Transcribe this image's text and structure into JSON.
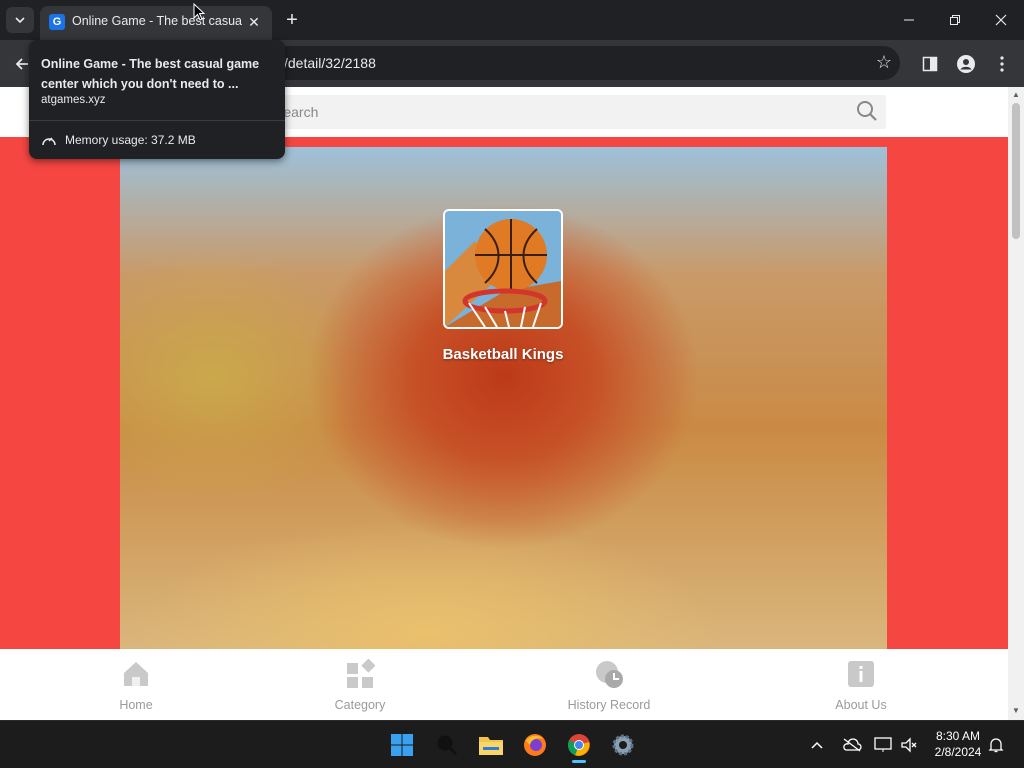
{
  "browser": {
    "tab": {
      "favicon_letter": "G",
      "title": "Online Game - The best casual game center which you don't need to ...",
      "close_symbol": "✕"
    },
    "new_tab_symbol": "+",
    "url": "/detail/32/2188",
    "window_controls": {
      "minimize": "—",
      "maximize": "❐",
      "close": "✕"
    }
  },
  "tooltip": {
    "title": "Online Game - The best casual game center which you don't need to ...",
    "domain": "atgames.xyz",
    "memory": "Memory usage: 37.2 MB"
  },
  "page": {
    "search": {
      "placeholder": "Search"
    },
    "game": {
      "title": "Basketball Kings"
    },
    "bottom_nav": [
      {
        "label": "Home",
        "icon": "home-icon"
      },
      {
        "label": "Category",
        "icon": "category-icon"
      },
      {
        "label": "History  Record",
        "icon": "history-icon"
      },
      {
        "label": "About  Us",
        "icon": "info-icon"
      }
    ],
    "colors": {
      "page_background": "#f64642",
      "nav_text": "#9a9a9a"
    }
  },
  "taskbar": {
    "apps": [
      {
        "name": "start",
        "icon": "windows-icon"
      },
      {
        "name": "search",
        "icon": "search-icon"
      },
      {
        "name": "file-explorer",
        "icon": "folder-icon"
      },
      {
        "name": "firefox",
        "icon": "firefox-icon"
      },
      {
        "name": "chrome",
        "icon": "chrome-icon",
        "active": true
      },
      {
        "name": "settings",
        "icon": "gear-icon"
      }
    ],
    "time": "8:30 AM",
    "date": "2/8/2024"
  }
}
